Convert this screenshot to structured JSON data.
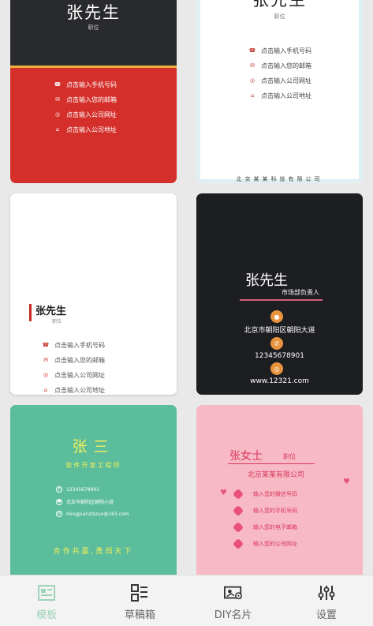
{
  "card_red": {
    "name": "张先生",
    "position": "职位",
    "info": [
      "点击输入手机号码",
      "点击输入您的邮箱",
      "点击输入公司网址",
      "点击输入公司地址"
    ]
  },
  "card_white_blue": {
    "name": "张先生",
    "position": "职位",
    "info": [
      "点击输入手机号码",
      "点击输入您的邮箱",
      "点击输入公司网址",
      "点击输入公司地址"
    ],
    "footer": "北京某某科技有限公司"
  },
  "card_white_left": {
    "name": "张先生",
    "position": "职位",
    "info": [
      "点击输入手机号码",
      "点击输入您的邮箱",
      "点击输入公司网址",
      "点击输入公司地址"
    ]
  },
  "card_dark": {
    "name": "张先生",
    "title": "市场部负责人",
    "address": "北京市朝阳区朝阳大道",
    "phone": "12345678901",
    "web": "www.12321.com"
  },
  "card_green": {
    "name": "张三",
    "job": "软件开发工程师",
    "info": [
      "12345678901",
      "北京市朝阳区朝阳小道",
      "mingpianzhizuo@163.com"
    ],
    "slogan": "合作共赢,勇闯天下"
  },
  "card_pink": {
    "name": "张女士",
    "position": "职位",
    "company": "北京某某有限公司",
    "info": [
      "输入您的微信号码",
      "输入您的手机号码",
      "输入您的电子邮箱",
      "输入您的公司网址"
    ]
  },
  "nav": {
    "tabs": [
      {
        "label": "模板",
        "icon": "template-icon"
      },
      {
        "label": "草稿箱",
        "icon": "drafts-icon"
      },
      {
        "label": "DIY名片",
        "icon": "diy-card-icon"
      },
      {
        "label": "设置",
        "icon": "settings-sliders-icon"
      }
    ],
    "active_index": 0,
    "active_color": "#9fd3ba"
  },
  "colors": {
    "red_card": "#d42f2a",
    "dark_card": "#1d1e21",
    "green_card": "#5bbd9b",
    "pink_card": "#f7b9c6"
  }
}
